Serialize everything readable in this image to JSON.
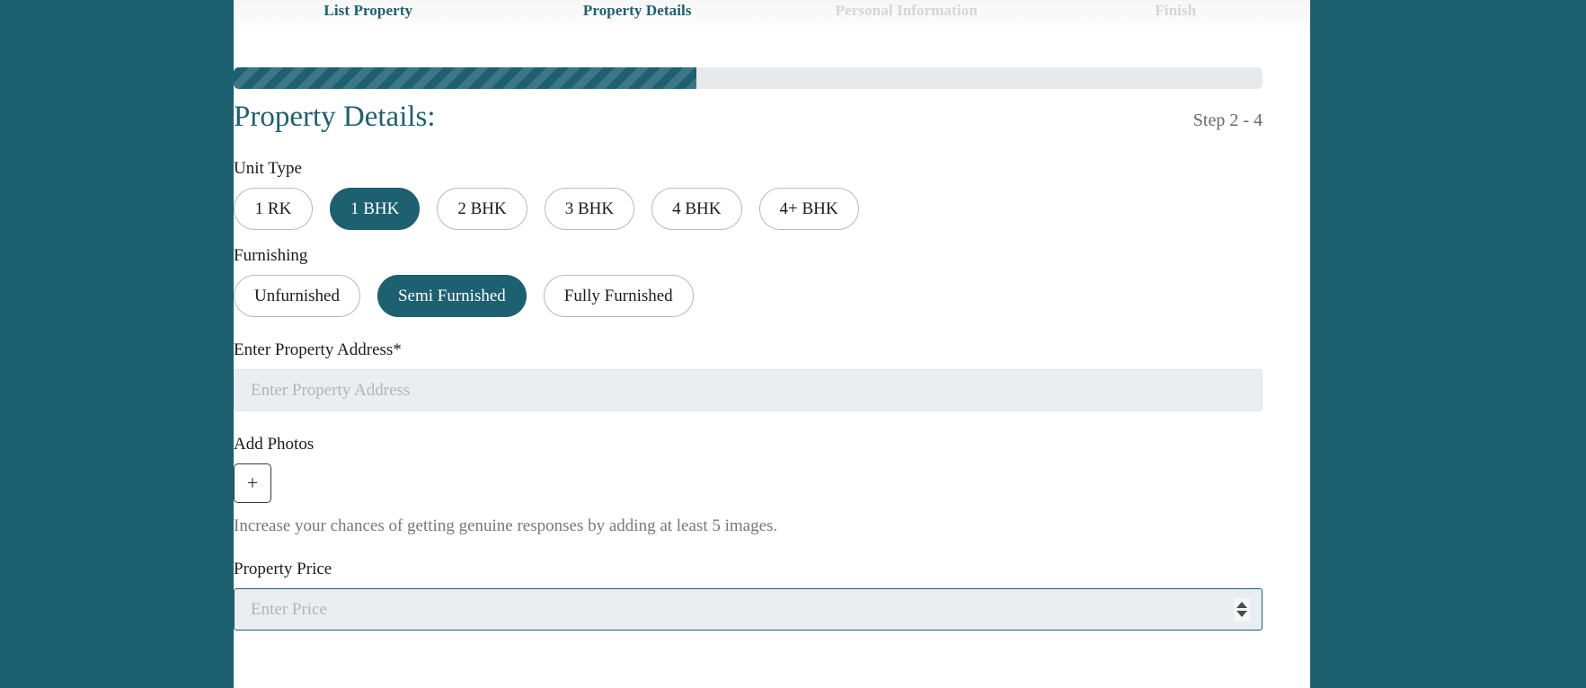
{
  "theme": {
    "accent": "#1d6070",
    "page_bg": "#1d6070",
    "card_bg": "#ffffff",
    "input_bg": "#eaeef0",
    "muted": "#d5d5d5"
  },
  "stepper": {
    "steps": [
      {
        "label": "List Property",
        "state": "complete"
      },
      {
        "label": "Property Details",
        "state": "active"
      },
      {
        "label": "Personal Information",
        "state": "inactive"
      },
      {
        "label": "Finish",
        "state": "inactive"
      }
    ]
  },
  "progress": {
    "percent": 45
  },
  "header": {
    "title": "Property Details:",
    "step_counter": "Step 2 - 4"
  },
  "unit_type": {
    "label": "Unit Type",
    "options": [
      {
        "label": "1 RK",
        "selected": false
      },
      {
        "label": "1 BHK",
        "selected": true
      },
      {
        "label": "2 BHK",
        "selected": false
      },
      {
        "label": "3 BHK",
        "selected": false
      },
      {
        "label": "4 BHK",
        "selected": false
      },
      {
        "label": "4+ BHK",
        "selected": false
      }
    ]
  },
  "furnishing": {
    "label": "Furnishing",
    "options": [
      {
        "label": "Unfurnished",
        "selected": false
      },
      {
        "label": "Semi Furnished",
        "selected": true
      },
      {
        "label": "Fully Furnished",
        "selected": false
      }
    ]
  },
  "address": {
    "label": "Enter Property Address*",
    "placeholder": "Enter Property Address",
    "value": ""
  },
  "photos": {
    "label": "Add Photos",
    "add_button_label": "+",
    "hint": "Increase your chances of getting genuine responses by adding at least 5 images."
  },
  "price": {
    "label": "Property Price",
    "placeholder": "Enter Price",
    "value": "",
    "focused": true,
    "spinner_up_icon": "caret-up-icon",
    "spinner_down_icon": "caret-down-icon"
  }
}
